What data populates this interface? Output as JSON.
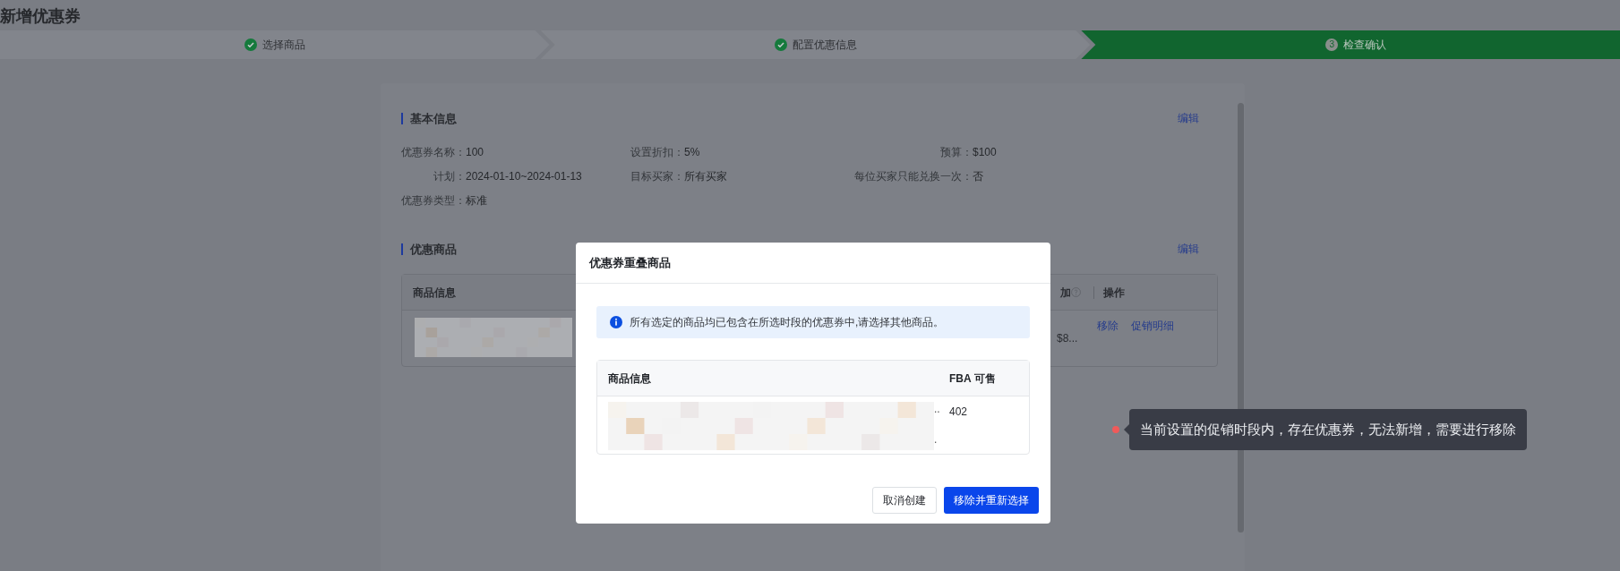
{
  "page_title": "新增优惠券",
  "steps": [
    {
      "label": "选择商品",
      "done": true,
      "selected": false
    },
    {
      "label": "配置优惠信息",
      "done": true,
      "selected": false
    },
    {
      "label": "检查确认",
      "number": "3",
      "done": false,
      "selected": true
    }
  ],
  "basic_info": {
    "title": "基本信息",
    "edit": "编辑",
    "columns": [
      [
        {
          "label": "优惠券名称：",
          "value": "100"
        },
        {
          "label": "计划：",
          "value": "2024-01-10~2024-01-13"
        },
        {
          "label": "优惠券类型：",
          "value": "标准"
        }
      ],
      [
        {
          "label": "设置折扣：",
          "value": "5%"
        },
        {
          "label": "目标买家：",
          "value": "所有买家"
        }
      ],
      [
        {
          "label": "预算：",
          "value": "$100"
        },
        {
          "label": "每位买家只能兑换一次：",
          "value": "否"
        }
      ]
    ]
  },
  "products": {
    "title": "优惠商品",
    "edit": "编辑",
    "table": {
      "columns": [
        "商品信息",
        "加",
        "操作"
      ],
      "rows": [
        {
          "column_2": "$8...",
          "actions": [
            "移除",
            "促销明细"
          ]
        }
      ]
    }
  },
  "modal": {
    "title": "优惠券重叠商品",
    "alert": "所有选定的商品均已包含在所选时段的优惠券中,请选择其他商品。",
    "table": {
      "columns": [
        "商品信息",
        "FBA 可售"
      ],
      "rows": [
        {
          "info_marks": [
            "..",
            "."
          ],
          "fba": "402"
        }
      ]
    },
    "buttons": [
      {
        "label": "取消创建",
        "kind": "secondary"
      },
      {
        "label": "移除并重新选择",
        "kind": "primary"
      }
    ]
  },
  "annotation": {
    "text": "当前设置的促销时段内，存在优惠券，无法新增，需要进行移除",
    "color": "#f05a5a"
  }
}
